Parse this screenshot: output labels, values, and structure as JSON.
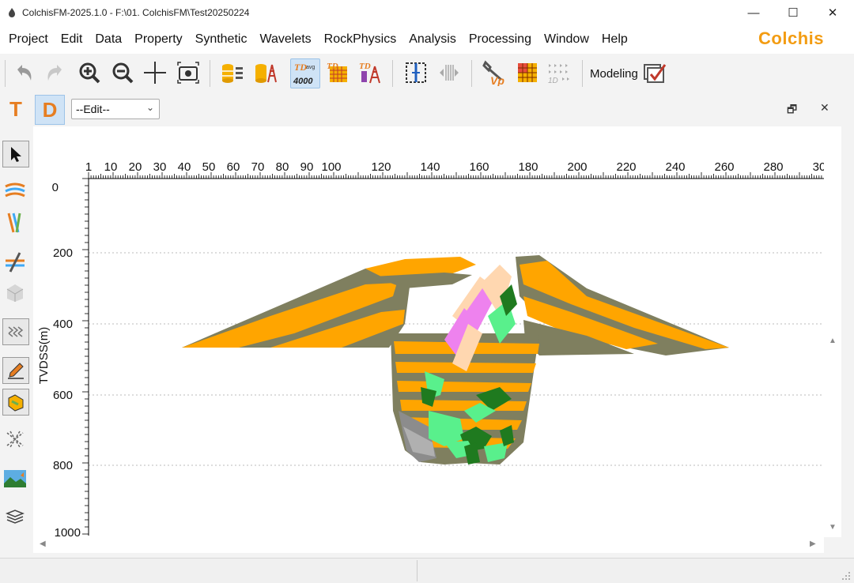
{
  "window": {
    "title": "ColchisFM-2025.1.0 - F:\\01. ColchisFM\\Test20250224",
    "minimize": "—",
    "maximize": "☐",
    "close": "✕"
  },
  "menu": [
    "Project",
    "Edit",
    "Data",
    "Property",
    "Synthetic",
    "Wavelets",
    "RockPhysics",
    "Analysis",
    "Processing",
    "Window",
    "Help"
  ],
  "brand": "Colchis",
  "toolbar": {
    "td_label": "TD",
    "td_sub": "avg",
    "td_value": "4000",
    "vp_label": "Vp",
    "modeling_label": "Modeling"
  },
  "panel": {
    "t_button": "T",
    "d_button": "D",
    "mode_select": "--Edit--",
    "restore": "🗗",
    "close": "✕"
  },
  "plot": {
    "y_axis_label": "TVDSS(m)",
    "x_ticks": [
      "1",
      "10",
      "20",
      "30",
      "40",
      "50",
      "60",
      "70",
      "80",
      "90",
      "100",
      "120",
      "140",
      "160",
      "180",
      "200",
      "220",
      "240",
      "260",
      "280",
      "30"
    ],
    "y_ticks": [
      "0",
      "200",
      "400",
      "600",
      "800",
      "1000"
    ],
    "colors": {
      "orange": "#ffa500",
      "olive_grey": "#7f7f5f",
      "pink": "#ee82ee",
      "green": "#59f08c",
      "dark_green": "#1f7a1f",
      "grey": "#8c8c8c",
      "peach": "#ffd7b0"
    }
  }
}
